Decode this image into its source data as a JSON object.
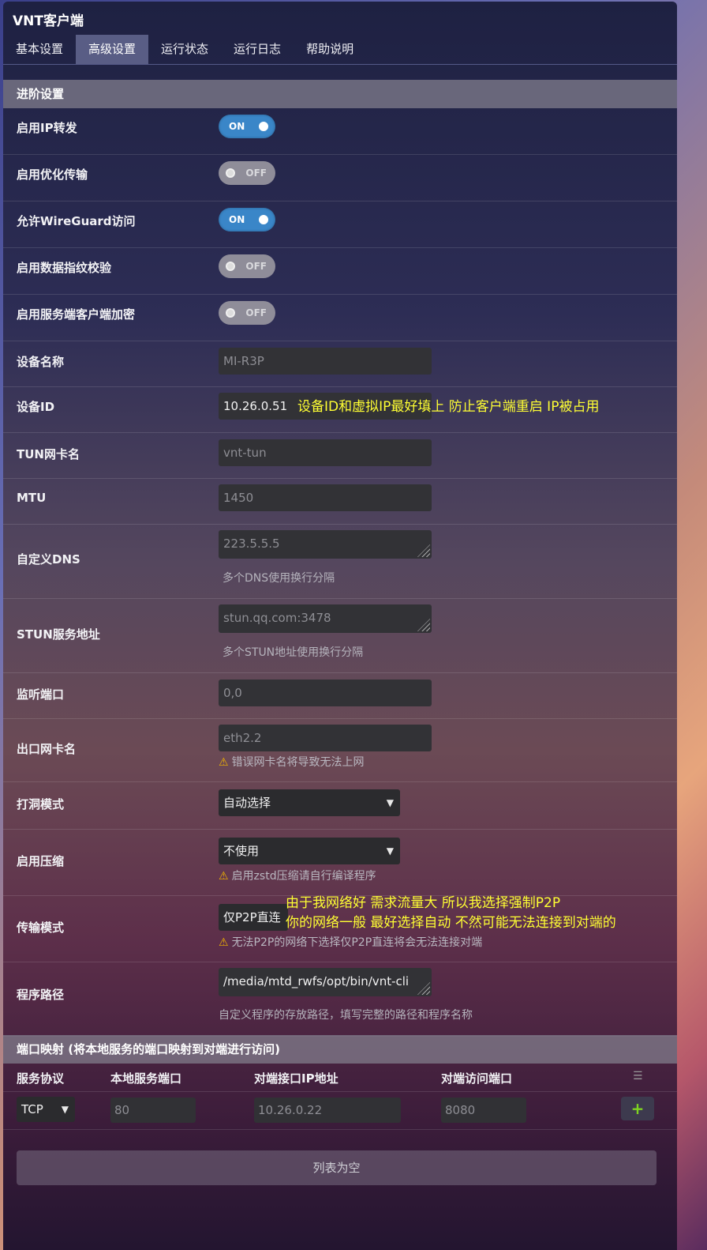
{
  "app": {
    "title": "VNT客户端"
  },
  "tabs": [
    {
      "label": "基本设置"
    },
    {
      "label": "高级设置"
    },
    {
      "label": "运行状态"
    },
    {
      "label": "运行日志"
    },
    {
      "label": "帮助说明"
    }
  ],
  "advanced": {
    "section_title": "进阶设置",
    "ip_forward": {
      "label": "启用IP转发",
      "state": "ON"
    },
    "optimize": {
      "label": "启用优化传输",
      "state": "OFF"
    },
    "wireguard": {
      "label": "允许WireGuard访问",
      "state": "ON"
    },
    "fingerprint": {
      "label": "启用数据指纹校验",
      "state": "OFF"
    },
    "encrypt": {
      "label": "启用服务端客户端加密",
      "state": "OFF"
    },
    "device_name": {
      "label": "设备名称",
      "placeholder": "MI-R3P"
    },
    "device_id": {
      "label": "设备ID",
      "value": "10.26.0.51"
    },
    "tun_name": {
      "label": "TUN网卡名",
      "placeholder": "vnt-tun"
    },
    "mtu": {
      "label": "MTU",
      "placeholder": "1450"
    },
    "dns": {
      "label": "自定义DNS",
      "placeholder": "223.5.5.5",
      "hint": "多个DNS使用换行分隔"
    },
    "stun": {
      "label": "STUN服务地址",
      "placeholder": "stun.qq.com:3478",
      "hint": "多个STUN地址使用换行分隔"
    },
    "listen_port": {
      "label": "监听端口",
      "placeholder": "0,0"
    },
    "out_iface": {
      "label": "出口网卡名",
      "placeholder": "eth2.2",
      "warning": "错误网卡名将导致无法上网"
    },
    "punch_mode": {
      "label": "打洞模式",
      "value": "自动选择"
    },
    "compress": {
      "label": "启用压缩",
      "value": "不使用",
      "warning": "启用zstd压缩请自行编译程序"
    },
    "transport": {
      "label": "传输模式",
      "value": "仅P2P直连",
      "warning": "无法P2P的网络下选择仅P2P直连将会无法连接对端"
    },
    "program_path": {
      "label": "程序路径",
      "value": "/media/mtd_rwfs/opt/bin/vnt-cli",
      "hint": "自定义程序的存放路径，填写完整的路径和程序名称"
    }
  },
  "annotations": {
    "device_id_note": "设备ID和虚拟IP最好填上 防止客户端重启 IP被占用",
    "transport_note_1": "由于我网络好 需求流量大  所以我选择强制P2P",
    "transport_note_2": "你的网络一般 最好选择自动  不然可能无法连接到对端的"
  },
  "port_mapping": {
    "section_title": "端口映射 (将本地服务的端口映射到对端进行访问)",
    "columns": [
      "服务协议",
      "本地服务端口",
      "对端接口IP地址",
      "对端访问端口"
    ],
    "new_row": {
      "protocol": "TCP",
      "local_port": "80",
      "peer_ip": "10.26.0.22",
      "peer_port": "8080"
    },
    "add_label": "+",
    "empty_label": "列表为空"
  },
  "colors": {
    "accent": "#3a86c8",
    "note": "#ffff33",
    "add": "#7ed321"
  }
}
